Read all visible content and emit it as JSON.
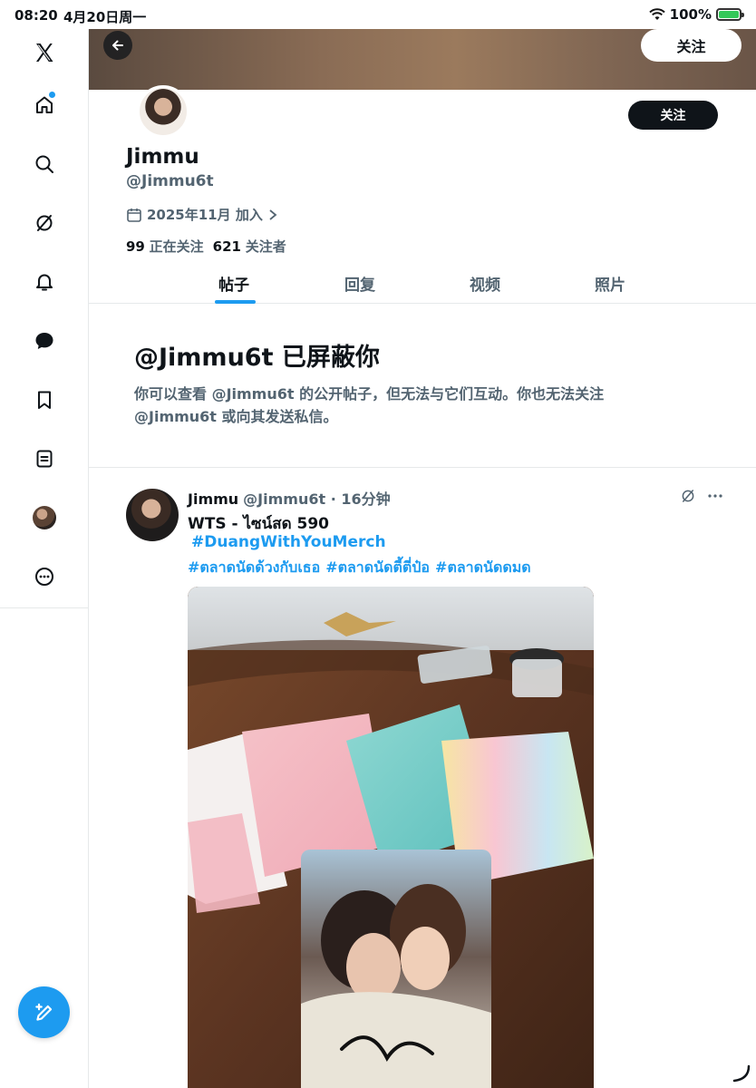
{
  "status_bar": {
    "time": "08:20",
    "date": "4月20日周一",
    "battery": "100%"
  },
  "nav": {
    "items": [
      "x-logo",
      "home",
      "search",
      "grok",
      "notifications",
      "messages",
      "bookmarks",
      "lists",
      "profile",
      "more"
    ]
  },
  "banner": {
    "follow_label": "关注"
  },
  "profile": {
    "name": "Jimmu",
    "handle": "@Jimmu6t",
    "joined": "2025年11月 加入",
    "following_count": "99",
    "following_label": "正在关注",
    "followers_count": "621",
    "followers_label": "关注者",
    "follow_label": "关注"
  },
  "tabs": [
    "帖子",
    "回复",
    "视频",
    "照片"
  ],
  "blocked": {
    "title": "@Jimmu6t 已屏蔽你",
    "desc_line1": "你可以查看 @Jimmu6t 的公开帖子，但无法与它们互动。你也无法关注",
    "desc_line2": "@Jimmu6t 或向其发送私信。"
  },
  "post": {
    "name": "Jimmu",
    "handle_time": "@Jimmu6t · 16分钟",
    "text": "WTS - ไซน์สด 590",
    "tag_main": "#DuangWithYouMerch",
    "tags": [
      "#ตลาดนัดด้วงกับเธอ",
      "#ตลาดนัดตี้ตี่ป๋อ",
      "#ตลาดนัดดมด"
    ]
  },
  "colors": {
    "accent": "#1d9bf0",
    "text": "#0f1419",
    "muted": "#536471"
  }
}
